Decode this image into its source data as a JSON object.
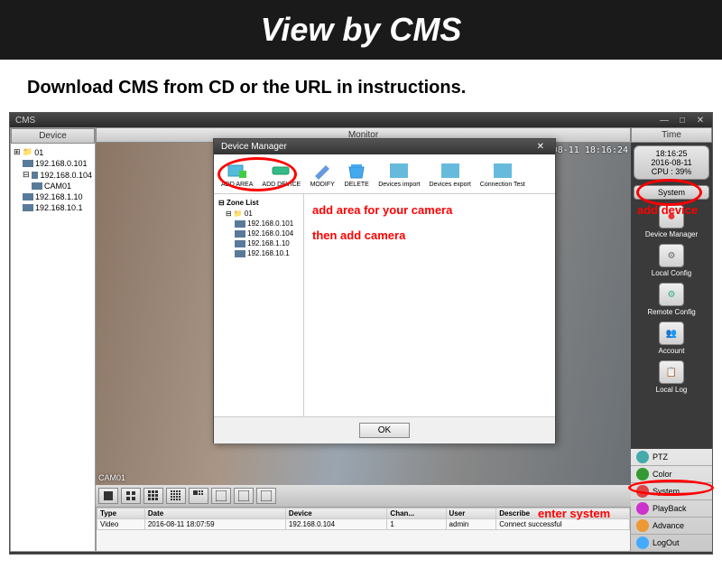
{
  "header": {
    "title": "View by CMS"
  },
  "subtitle": "Download CMS from CD or the URL in instructions.",
  "app": {
    "title": "CMS",
    "left": {
      "header": "Device",
      "tree": [
        {
          "label": "01",
          "indent": 0,
          "icon": "folder"
        },
        {
          "label": "192.168.0.101",
          "indent": 1,
          "icon": "cam"
        },
        {
          "label": "192.168.0.104",
          "indent": 1,
          "icon": "cam"
        },
        {
          "label": "CAM01",
          "indent": 2,
          "icon": "dev"
        },
        {
          "label": "192.168.1.10",
          "indent": 1,
          "icon": "cam"
        },
        {
          "label": "192.168.10.1",
          "indent": 1,
          "icon": "cam"
        }
      ]
    },
    "center": {
      "header": "Monitor",
      "timestamp": "2016-08-11 18:16:24",
      "cam_label": "CAM01"
    },
    "right": {
      "header": "Time",
      "time": "18:16:25",
      "date": "2016-08-11",
      "cpu": "CPU : 39%",
      "system_header": "System",
      "items": [
        {
          "label": "Device Manager",
          "icon": "red-dot"
        },
        {
          "label": "Local Config",
          "icon": "gear"
        },
        {
          "label": "Remote Config",
          "icon": "ctrl"
        },
        {
          "label": "Account",
          "icon": "users"
        },
        {
          "label": "Local Log",
          "icon": "log"
        }
      ],
      "menu": [
        {
          "label": "PTZ",
          "color": "#4aa"
        },
        {
          "label": "Color",
          "color": "#393"
        },
        {
          "label": "System",
          "color": "#d44"
        },
        {
          "label": "PlayBack",
          "color": "#c3c"
        },
        {
          "label": "Advance",
          "color": "#e93"
        },
        {
          "label": "LogOut",
          "color": "#4af"
        }
      ]
    },
    "log": {
      "headers": [
        "Type",
        "Date",
        "Device",
        "Chan...",
        "User",
        "Describe"
      ],
      "row": [
        "Video",
        "2016-08-11 18:07:59",
        "192.168.0.104",
        "1",
        "admin",
        "Connect successful"
      ]
    }
  },
  "dialog": {
    "title": "Device Manager",
    "tools": [
      "ADD AREA",
      "ADD DEVICE",
      "MODIFY",
      "DELETE",
      "Devices import",
      "Devices export",
      "Connection Test"
    ],
    "zone_title": "Zone List",
    "zone_items": [
      {
        "label": "01",
        "indent": 0
      },
      {
        "label": "192.168.0.101",
        "indent": 1
      },
      {
        "label": "192.168.0.104",
        "indent": 1
      },
      {
        "label": "192.168.1.10",
        "indent": 1
      },
      {
        "label": "192.168.10.1",
        "indent": 1
      }
    ],
    "ok": "OK"
  },
  "annotations": {
    "add_area": "add area for your camera",
    "then_add": "then add camera",
    "add_device": "add device",
    "enter_system": "enter system"
  }
}
